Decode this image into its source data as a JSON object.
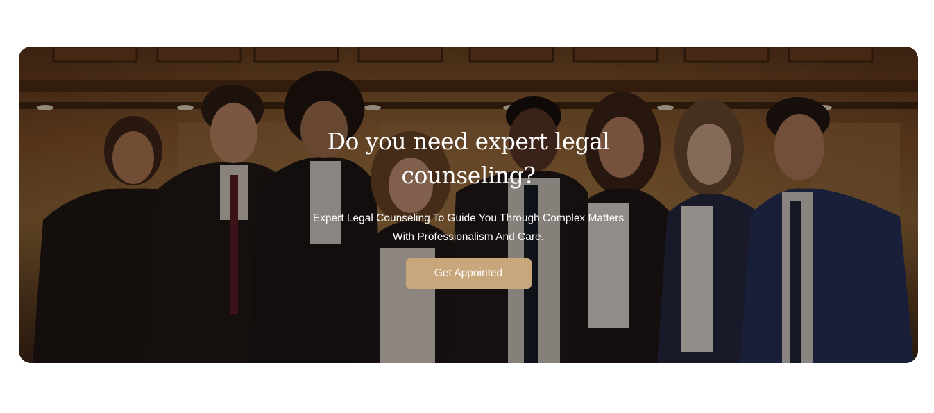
{
  "hero": {
    "title": "Do you need expert legal counseling?",
    "subtitle": "Expert Legal Counseling To Guide You Through Complex Matters With Professionalism And Care.",
    "cta_label": "Get Appointed",
    "image_alt": "Group of smiling young legal professionals in a wood-paneled courtroom",
    "colors": {
      "accent": "#c9a77c",
      "text": "#ffffff"
    }
  }
}
